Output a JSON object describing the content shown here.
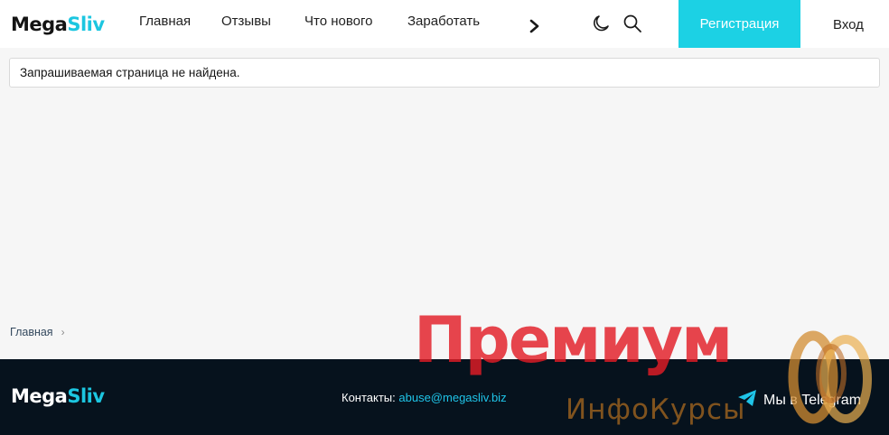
{
  "header": {
    "logo": {
      "part1": "Mega",
      "part2": "Sliv"
    },
    "nav": [
      "Главная",
      "Отзывы",
      "Что нового",
      "Заработать"
    ],
    "register_label": "Регистрация",
    "login_label": "Вход"
  },
  "notice": "Запрашиваемая страница не найдена.",
  "breadcrumb": {
    "home": "Главная"
  },
  "footer": {
    "logo": {
      "part1": "Mega",
      "part2": "Sliv"
    },
    "contacts_label": "Контакты:",
    "email": "abuse@megasliv.biz",
    "telegram_label": "Мы в Telegram"
  },
  "watermark": {
    "title": "Премиум",
    "subtitle": "ИнфоКурсы"
  },
  "colors": {
    "accent": "#1cd1e4",
    "footer_bg": "#06121d",
    "page_bg": "#f6f6f6"
  },
  "icons": [
    "chevron-right-icon",
    "moon-icon",
    "search-icon",
    "telegram-icon"
  ]
}
